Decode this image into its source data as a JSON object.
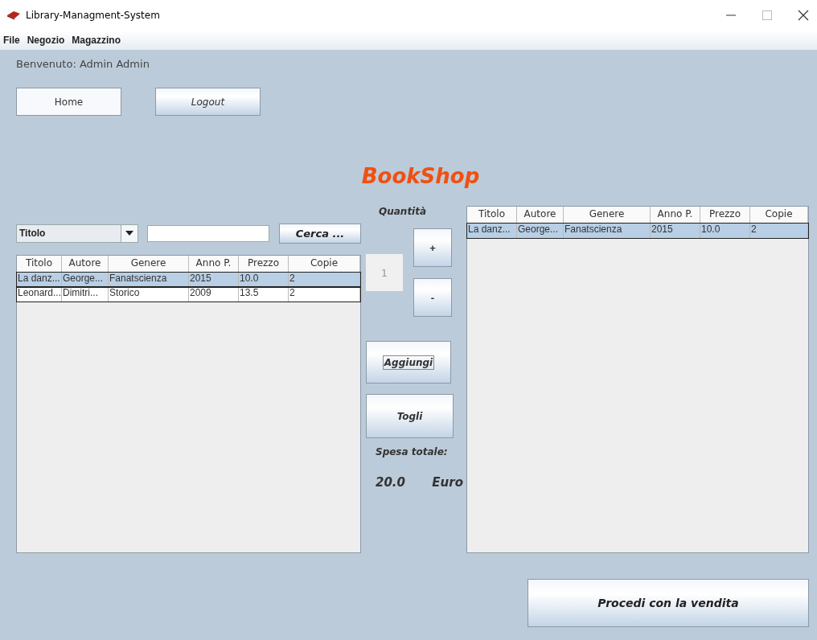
{
  "window": {
    "title": "Library-Managment-System"
  },
  "menu": [
    "File",
    "Negozio",
    "Magazzino"
  ],
  "welcome": "Benvenuto: Admin Admin",
  "nav_buttons": [
    {
      "label": "Home",
      "kind": "plain"
    },
    {
      "label": "Logout",
      "kind": "italic"
    }
  ],
  "heading": "BookShop",
  "search": {
    "field": "Titolo",
    "button": "Cerca ..."
  },
  "catalog_table": {
    "columns": [
      "Titolo",
      "Autore",
      "Genere",
      "Anno P.",
      "Prezzo",
      "Copie"
    ],
    "rows": [
      {
        "cells": [
          "La danz...",
          "George...",
          "Fanatscienza",
          "2015",
          "10.0",
          "2"
        ],
        "selected": true
      },
      {
        "cells": [
          "Leonard...",
          "Dimitri...",
          "Storico",
          "2009",
          "13.5",
          "2"
        ],
        "selected": false
      }
    ]
  },
  "quantity": {
    "label": "Quantità",
    "value": "1",
    "disabled": true,
    "plus": "+",
    "minus": "-"
  },
  "actions": [
    {
      "label": "Aggiungi",
      "focused": true
    },
    {
      "label": "Togli",
      "focused": false
    }
  ],
  "total": {
    "label": "Spesa totale:",
    "amount": "20.0",
    "currency": "Euro"
  },
  "cart_table": {
    "columns": [
      "Titolo",
      "Autore",
      "Genere",
      "Anno P.",
      "Prezzo",
      "Copie"
    ],
    "rows": [
      {
        "cells": [
          "La danz...",
          "George...",
          "Fanatscienza",
          "2015",
          "10.0",
          "2"
        ],
        "selected": true
      }
    ]
  },
  "proceed_button": "Procedi con la vendita"
}
